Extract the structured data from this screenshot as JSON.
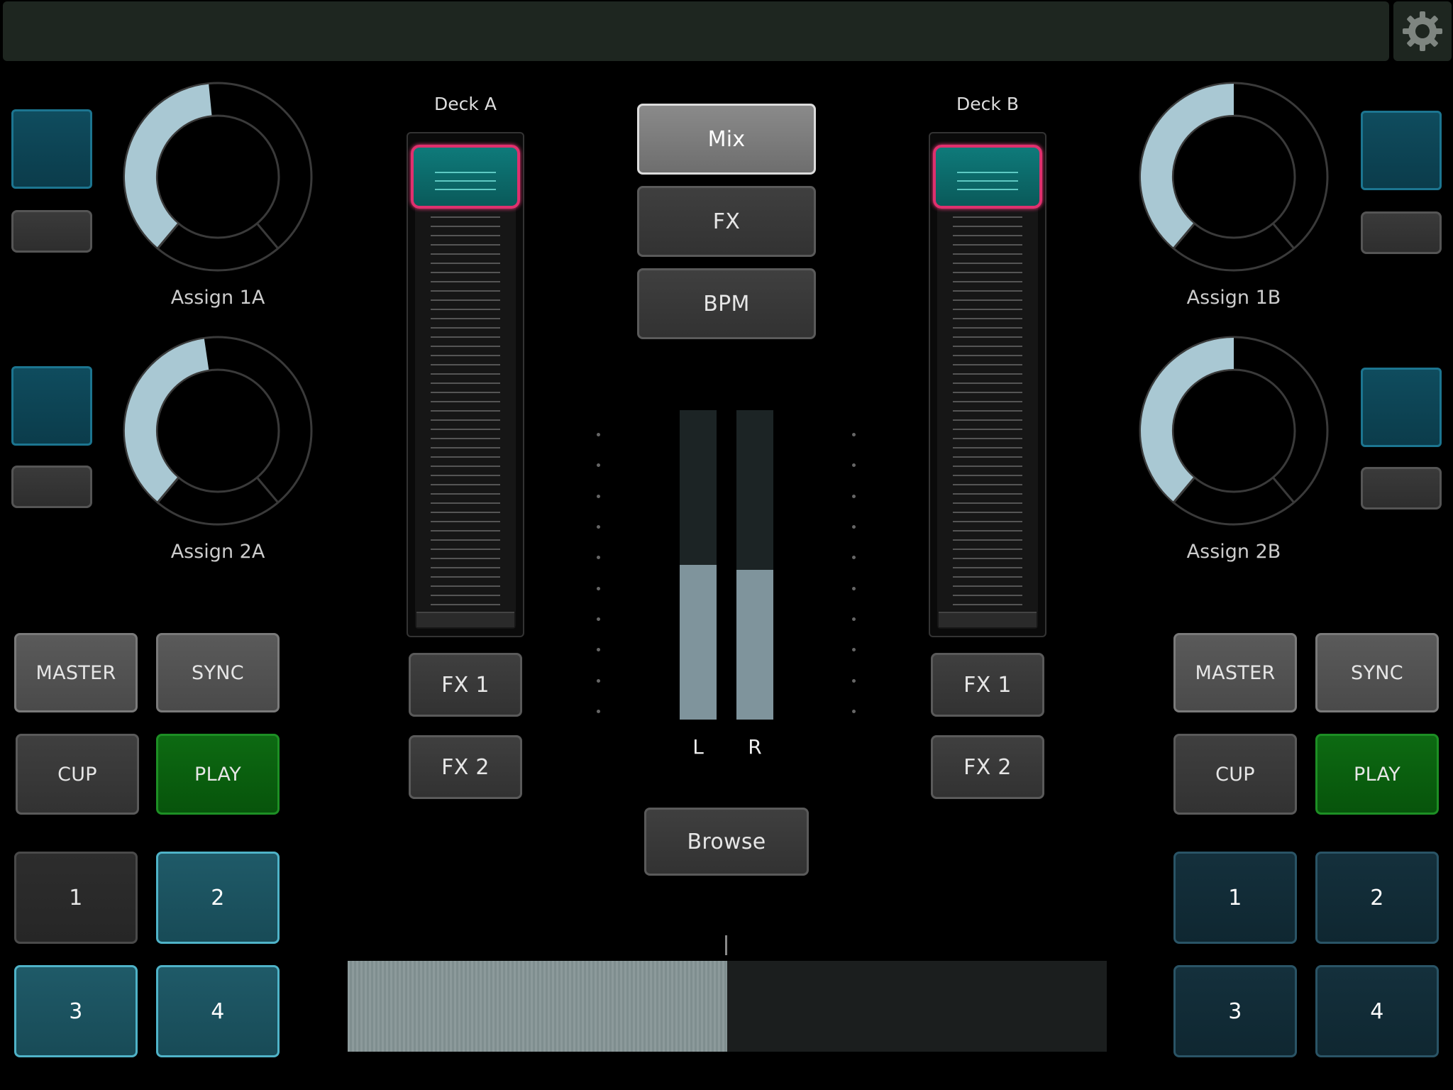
{
  "colors": {
    "accent_teal": "#0e7a7a",
    "fader_highlight": "#e0306e",
    "play_green": "#0d6a12",
    "knob_arc": "#a9c8d3",
    "meter_fill": "#7f949c"
  },
  "header": {
    "settings_icon": "gear-icon"
  },
  "deck_a": {
    "label": "Deck A",
    "knobs": [
      {
        "label": "Assign 1A",
        "value": 0.48
      },
      {
        "label": "Assign 2A",
        "value": 0.47
      }
    ],
    "fader_level": 1.0,
    "fx_buttons": [
      "FX 1",
      "FX 2"
    ],
    "transport": {
      "master": "MASTER",
      "sync": "SYNC",
      "cue": "CUP",
      "play": "PLAY"
    },
    "cues": [
      {
        "label": "1",
        "active": false
      },
      {
        "label": "2",
        "active": true
      },
      {
        "label": "3",
        "active": true
      },
      {
        "label": "4",
        "active": true
      }
    ]
  },
  "deck_b": {
    "label": "Deck B",
    "knobs": [
      {
        "label": "Assign 1B",
        "value": 0.5
      },
      {
        "label": "Assign 2B",
        "value": 0.5
      }
    ],
    "fader_level": 1.0,
    "fx_buttons": [
      "FX 1",
      "FX 2"
    ],
    "transport": {
      "master": "MASTER",
      "sync": "SYNC",
      "cue": "CUP",
      "play": "PLAY"
    },
    "cues": [
      {
        "label": "1",
        "active": false
      },
      {
        "label": "2",
        "active": false
      },
      {
        "label": "3",
        "active": false
      },
      {
        "label": "4",
        "active": false
      }
    ]
  },
  "center": {
    "mode_buttons": [
      "Mix",
      "FX",
      "BPM"
    ],
    "selected_mode": "Mix",
    "browse": "Browse",
    "meters": [
      {
        "label": "L",
        "level": 0.5
      },
      {
        "label": "R",
        "level": 0.485
      }
    ],
    "crossfader": 0.5
  }
}
